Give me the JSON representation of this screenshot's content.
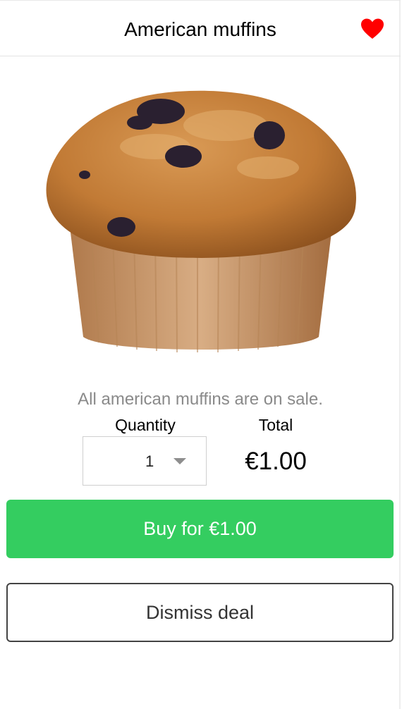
{
  "header": {
    "title": "American muffins",
    "favorite_icon": "heart-icon",
    "favorite_color": "#ff0000",
    "favorited": true
  },
  "product": {
    "image_icon": "blueberry-muffin-image",
    "sale_text": "All american muffins are on sale."
  },
  "order": {
    "quantity_label": "Quantity",
    "quantity_value": "1",
    "total_label": "Total",
    "total_value": "€1.00"
  },
  "actions": {
    "buy_label": "Buy for €1.00",
    "buy_color": "#34cd60",
    "dismiss_label": "Dismiss deal"
  }
}
